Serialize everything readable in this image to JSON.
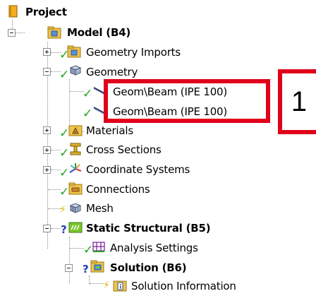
{
  "tree": {
    "project": "Project",
    "model": "Model (B4)",
    "geometry_imports": "Geometry Imports",
    "geometry": "Geometry",
    "beam_1": "Geom\\Beam (IPE 100)",
    "beam_2": "Geom\\Beam (IPE 100)",
    "materials": "Materials",
    "cross_sections": "Cross Sections",
    "coordinate_systems": "Coordinate Systems",
    "connections": "Connections",
    "mesh": "Mesh",
    "static_structural": "Static Structural (B5)",
    "analysis_settings": "Analysis Settings",
    "solution": "Solution (B6)",
    "solution_information": "Solution Information"
  },
  "status_icons": {
    "solved": "✓",
    "needs_update": "⚡",
    "undefined": "?"
  },
  "callout": {
    "number": "1"
  },
  "colors": {
    "highlight": "#e0001b",
    "check": "#22a322",
    "bolt": "#d9b200",
    "question": "#1b3fb5"
  }
}
